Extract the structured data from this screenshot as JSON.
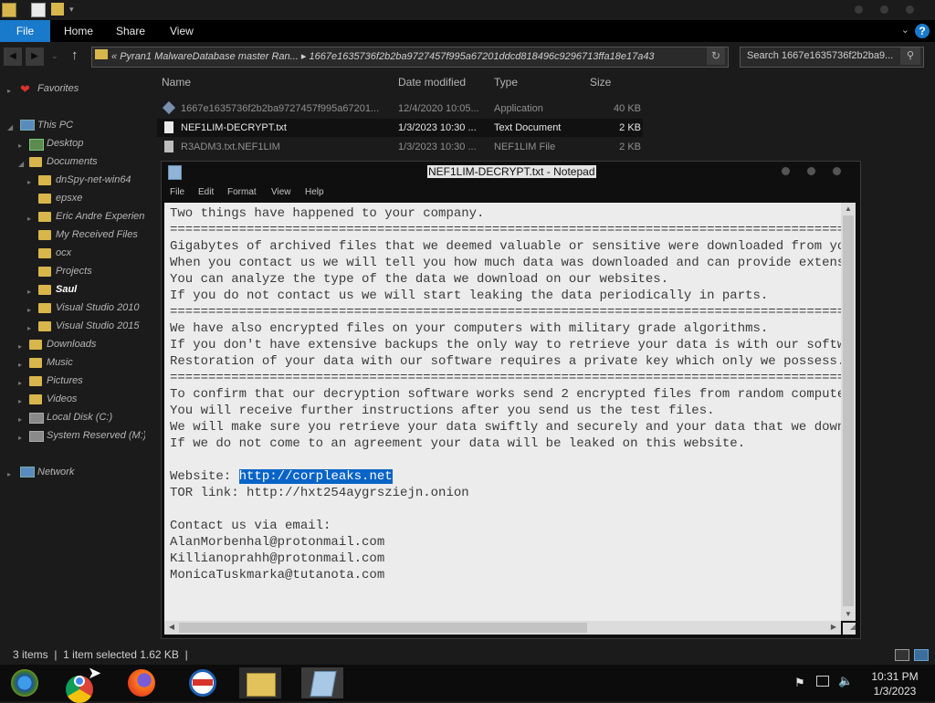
{
  "ribbon": {
    "file_label": "File",
    "tabs": [
      "Home",
      "Share",
      "View"
    ],
    "help": "?"
  },
  "address": {
    "path_prefix": "«",
    "path_part1": "Pyran1 MalwareDatabase master Ran...",
    "separator": "▸",
    "path_part2": "1667e1635736f2b2ba9727457f995a67201ddcd818496c9296713ffa18e17a43",
    "search_placeholder": "Search 1667e1635736f2b2ba9..."
  },
  "sidebar": {
    "favorites": "Favorites",
    "this_pc": "This PC",
    "items": [
      "Desktop",
      "Documents",
      "dnSpy-net-win64",
      "epsxe",
      "Eric Andre Experien",
      "My Received Files",
      "ocx",
      "Projects",
      "Saul",
      "Visual Studio 2010",
      "Visual Studio 2015",
      "Downloads",
      "Music",
      "Pictures",
      "Videos",
      "Local Disk (C:)",
      "System Reserved (M:)"
    ],
    "network": "Network"
  },
  "filelist": {
    "headers": [
      "Name",
      "Date modified",
      "Type",
      "Size"
    ],
    "rows": [
      {
        "name": "1667e1635736f2b2ba9727457f995a67201...",
        "date": "12/4/2020 10:05...",
        "type": "Application",
        "size": "40 KB"
      },
      {
        "name": "NEF1LIM-DECRYPT.txt",
        "date": "1/3/2023 10:30 ...",
        "type": "Text Document",
        "size": "2 KB"
      },
      {
        "name": "R3ADM3.txt.NEF1LIM",
        "date": "1/3/2023 10:30 ...",
        "type": "NEF1LIM File",
        "size": "2 KB"
      }
    ]
  },
  "notepad": {
    "title": "NEF1LIM-DECRYPT.txt - Notepad",
    "menu": [
      "File",
      "Edit",
      "Format",
      "View",
      "Help"
    ],
    "lines": [
      "Two things have happened to your company.",
      "==============================================================================================",
      "Gigabytes of archived files that we deemed valuable or sensitive were downloaded from your n",
      "When you contact us we will tell you how much data was downloaded and can provide extensive",
      "You can analyze the type of the data we download on our websites.",
      "If you do not contact us we will start leaking the data periodically in parts.",
      "==============================================================================================",
      "We have also encrypted files on your computers with military grade algorithms.",
      "If you don't have extensive backups the only way to retrieve your data is with our software.",
      "Restoration of your data with our software requires a private key which only we possess.",
      "==============================================================================================",
      "To confirm that our decryption software works send 2 encrypted files from random computers t",
      "You will receive further instructions after you send us the test files.",
      "We will make sure you retrieve your data swiftly and securely and your data that we download",
      "If we do not come to an agreement your data will be leaked on this website.",
      ""
    ],
    "website_label": "Website: ",
    "website_url": "http://corpleaks.net",
    "tor_line": "TOR link: http://hxt254aygrsziejn.onion",
    "blank": "",
    "contact_label": "Contact us via email:",
    "emails": [
      "AlanMorbenhal@protonmail.com",
      "Killianoprahh@protonmail.com",
      "MonicaTuskmarka@tutanota.com"
    ]
  },
  "status": {
    "items": "3 items",
    "sep": "|",
    "selected": "1 item selected  1.62 KB",
    "sep2": "|"
  },
  "clock": {
    "time": "10:31 PM",
    "date": "1/3/2023"
  },
  "colors": {
    "accent": "#1979ca",
    "folder": "#d8b64b",
    "selection": "#0a64c8"
  }
}
